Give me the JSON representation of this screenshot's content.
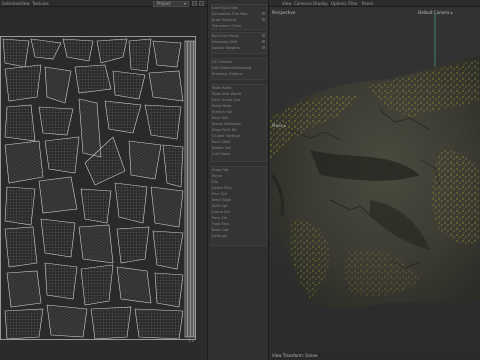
{
  "topbar": {
    "menus": [
      "Selection",
      "View",
      "Textures"
    ],
    "project_select": "Project"
  },
  "uv_panel": {
    "corner_label": "1.0"
  },
  "mid_panel": {
    "rows": [
      "Load Sub-Files",
      "Simulation Flat Map",
      "Auto Merging",
      "Transform Chnls",
      "Bg Chnls Mode",
      "Dropping Shift",
      "Aspect Weights",
      "UV Checker",
      "Edit Material/Mapping",
      "Stacking Options",
      "Texel Ratio",
      "Texel Size World",
      "Pack Group Opt",
      "Relax Rate",
      "Stretch Opt",
      "Pack Opt",
      "Visual Distortion",
      "Align Pack Dir",
      "Cluster Settings",
      "Pack Shell",
      "Rotate Set",
      "Cut Edges",
      "Snap Opt",
      "Mirror",
      "Flip",
      "Select Pins",
      "Pins Opt",
      "Weld Edge",
      "Split Opt",
      "Group Set",
      "Pack Sel",
      "Flow Pack",
      "Bake Opt",
      "Settings"
    ]
  },
  "viewport": {
    "menus": [
      "View",
      "Cameras",
      "Display",
      "Options",
      "Filter",
      "Panel"
    ],
    "perspective_label": "Perspective",
    "camera_label": "Default Camera ▸",
    "move_label": "Move ▸",
    "footer_label": "View Transform: Scene"
  },
  "colors": {
    "uv_lines": "#cfcfcf",
    "rock_dark": "#3a3b33",
    "rock_moss": "#8a8a2e",
    "rock_yellow": "#b8a736"
  }
}
